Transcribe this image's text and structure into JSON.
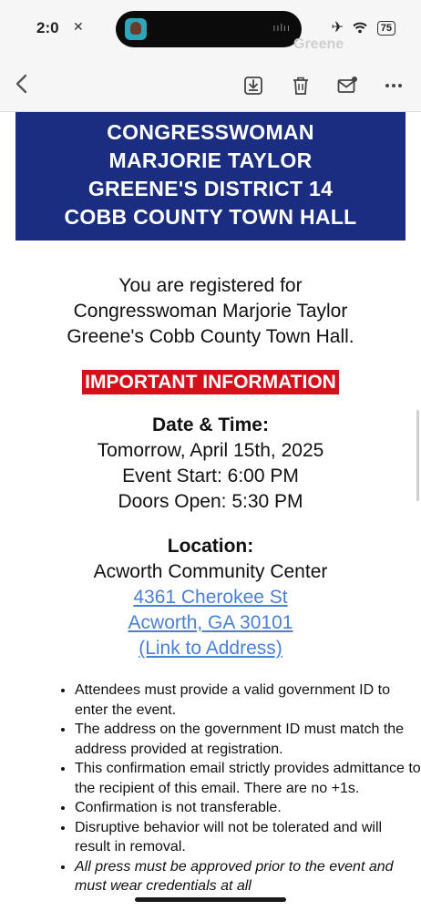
{
  "status_bar": {
    "time": "2:0",
    "mute_icon": "bell-slash-icon",
    "airplane_icon": "airplane-icon",
    "wifi_icon": "wifi-icon",
    "battery": "75",
    "island_activity": "ıılıı",
    "faded_brand": "Greene"
  },
  "toolbar": {
    "back_icon": "chevron-left-icon",
    "archive_icon": "archive-download-icon",
    "trash_icon": "trash-icon",
    "mark_unread_icon": "mail-unread-icon",
    "more_icon": "more-horizontal-icon"
  },
  "banner": {
    "lines": [
      "CONGRESSWOMAN",
      "MARJORIE TAYLOR",
      "GREENE'S DISTRICT 14",
      "COBB COUNTY TOWN HALL"
    ]
  },
  "intro": {
    "lines": [
      "You are registered for",
      "Congresswoman Marjorie Taylor",
      "Greene's Cobb County Town Hall."
    ]
  },
  "important_label": "IMPORTANT INFORMATION",
  "date_time": {
    "heading": "Date & Time:",
    "date": "Tomorrow, April 15th, 2025",
    "event_start": "Event Start: 6:00 PM",
    "doors_open": "Doors Open: 5:30 PM"
  },
  "location": {
    "heading": "Location:",
    "venue": "Acworth Community Center",
    "street": "4361 Cherokee St",
    "city": "Acworth, GA 30101",
    "map_link": "(Link to Address)"
  },
  "bullets": [
    "Attendees must provide a valid government ID to enter the event.",
    "The address on the government ID must match the address provided at registration.",
    "This confirmation email strictly provides admittance to the recipient of this email. There are no +1s.",
    "Confirmation is not transferable.",
    "Disruptive behavior will not be tolerated and will result in removal.",
    "All press must be approved prior to the event and must wear credentials at all"
  ],
  "colors": {
    "banner_bg": "#1a2d80",
    "important_bg": "#d4111a",
    "link": "#4a7fd6"
  }
}
